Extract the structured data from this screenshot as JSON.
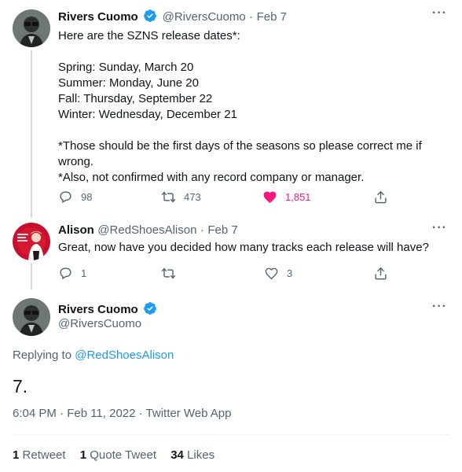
{
  "tweet1": {
    "author_name": "Rivers Cuomo",
    "handle": "@RiversCuomo",
    "separator": "·",
    "date": "Feb 7",
    "body": "Here are the SZNS release dates*:\n\nSpring: Sunday, March 20\nSummer: Monday, June 20\nFall: Thursday, September 22\nWinter: Wednesday, December 21\n\n*Those should be the first days of the seasons so please correct me if wrong.\n*Also, not confirmed with any record company or manager.",
    "replies": "98",
    "retweets": "473",
    "likes": "1,851",
    "liked": true
  },
  "tweet2": {
    "author_name": "Alison",
    "handle": "@RedShoesAlison",
    "separator": "·",
    "date": "Feb 7",
    "body": "Great, now have you decided how many tracks each release will have?",
    "replies": "1",
    "retweets": "",
    "likes": "3"
  },
  "main_tweet": {
    "author_name": "Rivers Cuomo",
    "handle": "@RiversCuomo",
    "replying_prefix": "Replying to",
    "replying_to": "@RedShoesAlison",
    "body": "7.",
    "timestamp": "6:04 PM · Feb 11, 2022 · Twitter Web App",
    "stats": {
      "retweets_count": "1",
      "retweets_label": "Retweet",
      "quotes_count": "1",
      "quotes_label": "Quote Tweet",
      "likes_count": "34",
      "likes_label": "Likes"
    }
  },
  "colors": {
    "accent": "#1d9bf0",
    "like": "#f91880",
    "muted": "#536471",
    "text": "#0f1419"
  },
  "icons": [
    "verified-badge-icon",
    "more-icon",
    "reply-icon",
    "retweet-icon",
    "like-icon",
    "share-icon"
  ]
}
